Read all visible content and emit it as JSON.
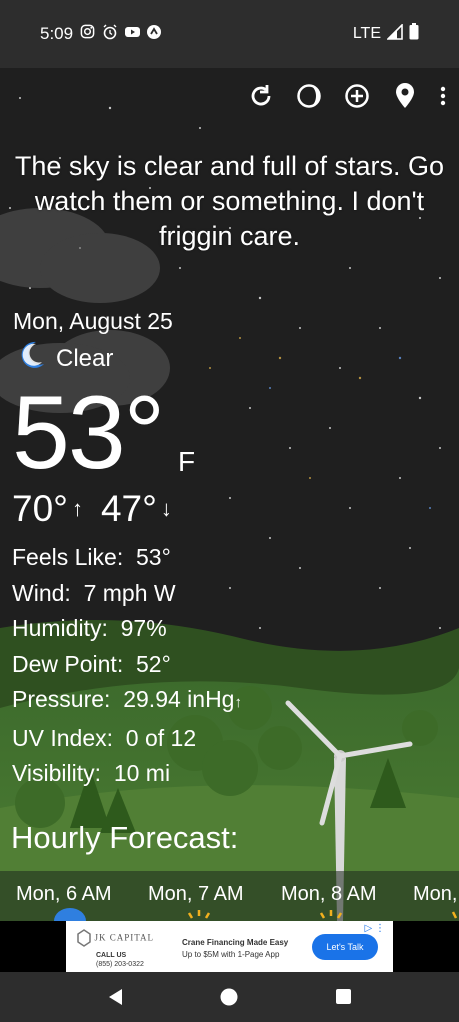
{
  "status_bar": {
    "time": "5:09",
    "network": "LTE",
    "icons": [
      "instagram-icon",
      "alarm-icon",
      "youtube-icon",
      "app-icon",
      "signal-icon",
      "battery-icon"
    ]
  },
  "toolbar": {
    "icons": [
      "refresh-icon",
      "moon-phase-icon",
      "add-location-icon",
      "location-pin-icon",
      "more-vert-icon"
    ]
  },
  "headline": "The sky is clear and full of stars. Go watch them or something. I don't friggin care.",
  "current": {
    "date": "Mon, August 25",
    "condition": "Clear",
    "temperature": "53°",
    "unit": "F",
    "high": "70°",
    "low": "47°",
    "high_arrow": "↑",
    "low_arrow": "↓"
  },
  "details": [
    {
      "label": "Feels Like:",
      "value": "53°"
    },
    {
      "label": "Wind:",
      "value": "7 mph W"
    },
    {
      "label": "Humidity:",
      "value": "97%"
    },
    {
      "label": "Dew Point:",
      "value": "52°"
    },
    {
      "label": "Pressure:",
      "value": "29.94 inHg",
      "trend": "↑"
    },
    {
      "label": "UV Index:",
      "value": "0 of 12"
    },
    {
      "label": "Visibility:",
      "value": "10 mi"
    }
  ],
  "hourly": {
    "title": "Hourly Forecast:",
    "items": [
      "Mon, 6 AM",
      "Mon, 7 AM",
      "Mon, 8 AM",
      "Mon,"
    ]
  },
  "ad": {
    "brand": "JK CAPITAL",
    "call_label": "CALL US",
    "phone": "(855) 203-0322",
    "headline": "Crane Financing Made Easy",
    "body": "Up to $5M with 1-Page App",
    "cta": "Let's Talk"
  },
  "colors": {
    "status_bar": "#2d2d2d",
    "sky": "#1e1e1e",
    "grass": "#4a7a2e",
    "ad_cta": "#1a73e8"
  }
}
